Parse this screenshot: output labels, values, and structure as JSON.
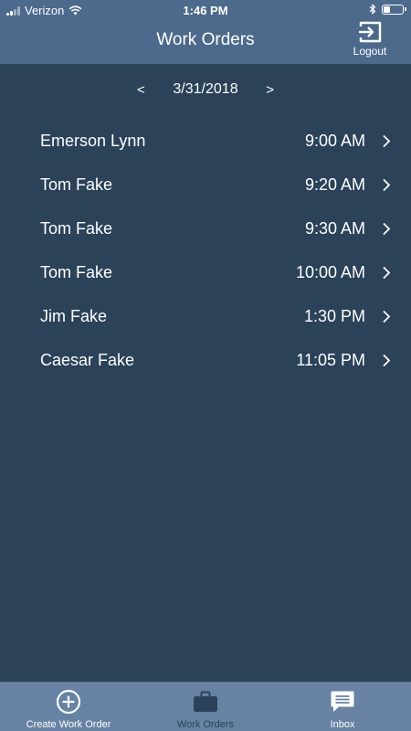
{
  "status_bar": {
    "carrier": "Verizon",
    "time": "1:46 PM",
    "battery_level": 0.35
  },
  "header": {
    "title": "Work Orders",
    "logout_label": "Logout"
  },
  "date_nav": {
    "prev": "<",
    "date": "3/31/2018",
    "next": ">"
  },
  "orders": [
    {
      "name": "Emerson Lynn",
      "time": "9:00 AM"
    },
    {
      "name": "Tom Fake",
      "time": "9:20 AM"
    },
    {
      "name": "Tom Fake",
      "time": "9:30 AM"
    },
    {
      "name": "Tom Fake",
      "time": "10:00 AM"
    },
    {
      "name": "Jim Fake",
      "time": "1:30 PM"
    },
    {
      "name": "Caesar Fake",
      "time": "11:05 PM"
    }
  ],
  "tab_bar": {
    "tabs": [
      {
        "label": "Create Work Order",
        "icon": "plus-circle-icon"
      },
      {
        "label": "Work Orders",
        "icon": "briefcase-icon",
        "active": true
      },
      {
        "label": "Inbox",
        "icon": "chat-bubble-icon"
      }
    ]
  },
  "colors": {
    "background": "#2b4259",
    "header": "#4d6a8c",
    "tab_bar": "#6782a3",
    "text": "#ffffff"
  }
}
